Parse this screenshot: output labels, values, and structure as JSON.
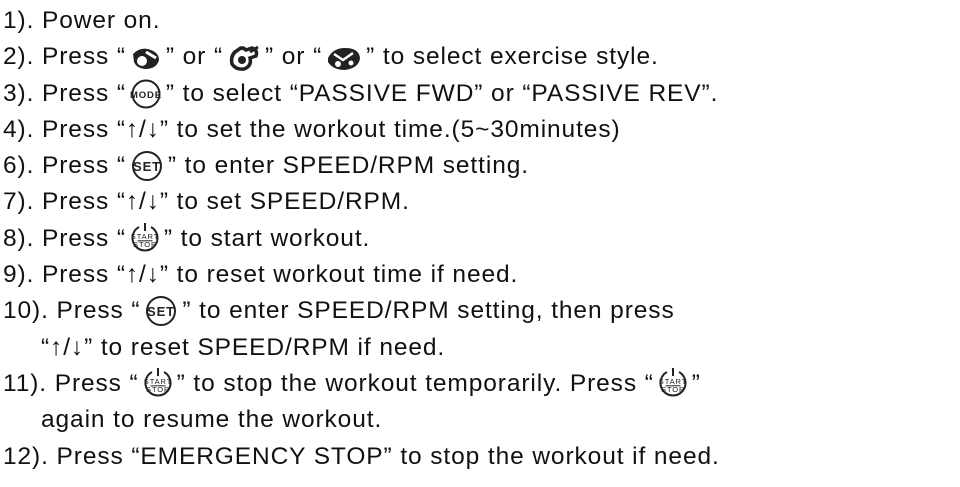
{
  "instructions": [
    {
      "id": "s1",
      "parts": [
        "1). Power on."
      ]
    },
    {
      "id": "s2",
      "parts": [
        "2). Press “",
        "icon:handcycle-icon",
        "” or “",
        "icon:leg-cycle-icon",
        "” or “",
        "icon:arm-leg-cycle-icon",
        "” to select exercise style."
      ]
    },
    {
      "id": "s3",
      "parts": [
        "3). Press “",
        "icon:mode-button-icon",
        "” to select “PASSIVE FWD” or “PASSIVE  REV”."
      ]
    },
    {
      "id": "s4",
      "parts": [
        "4). Press “↑/↓” to set the workout time.(5~30minutes)"
      ]
    },
    {
      "id": "s6",
      "parts": [
        "6). Press “",
        "icon:set-button-icon",
        "” to enter SPEED/RPM setting."
      ]
    },
    {
      "id": "s7",
      "parts": [
        "7). Press “↑/↓” to  set SPEED/RPM."
      ]
    },
    {
      "id": "s8",
      "parts": [
        "8). Press “",
        "icon:start-stop-button-icon",
        "” to start workout."
      ]
    },
    {
      "id": "s9",
      "parts": [
        "9). Press “↑/↓” to reset workout time if need."
      ]
    },
    {
      "id": "s10",
      "parts": [
        "10). Press “",
        "icon:set-button-icon",
        "” to enter SPEED/RPM setting, then press"
      ]
    },
    {
      "id": "s10b",
      "indent": true,
      "parts": [
        "“↑/↓” to reset SPEED/RPM if need."
      ]
    },
    {
      "id": "s11",
      "parts": [
        "11). Press “",
        "icon:start-stop-button-icon",
        "” to stop the workout temporarily. Press “",
        "icon:start-stop-button-icon",
        "”"
      ]
    },
    {
      "id": "s11b",
      "indent": true,
      "parts": [
        "again to resume the workout."
      ]
    },
    {
      "id": "s12",
      "parts": [
        "12). Press “EMERGENCY STOP” to stop the workout if need."
      ]
    }
  ],
  "button_labels": {
    "mode": "MODE",
    "set": "SET",
    "start": "START",
    "stop": "STOP"
  },
  "colors": {
    "text": "#111111",
    "icon": "#222222"
  }
}
